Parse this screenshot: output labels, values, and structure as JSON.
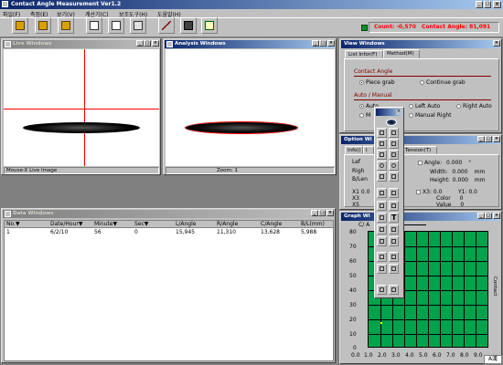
{
  "app": {
    "title": "Contact Angle Measurement Ver1.2"
  },
  "menu": [
    "파일(F)",
    "측정(E)",
    "보기(V)",
    "계산기(C)",
    "보조도구(H)",
    "도움말(H)"
  ],
  "status_top": {
    "count_label": "Count:",
    "count_value": "-0,570",
    "angle_label": "Contact Angle:",
    "angle_value": "81,091"
  },
  "live_window": {
    "title": "Live Windows",
    "status": "Mouse-X Live Image"
  },
  "analysis_window": {
    "title": "Analysis Windows",
    "status": "Zoom: 1"
  },
  "data_window": {
    "title": "Data Windows",
    "columns": [
      "No.▼",
      "Date/Hour▼",
      "Minute▼",
      "Sec▼",
      "L/Angle",
      "R/Angle",
      "C/Angle",
      "B/L(mm)"
    ],
    "rows": [
      [
        "1",
        "6/2/10",
        "56",
        "0",
        "15,945",
        "11,310",
        "13,628",
        "5,988"
      ]
    ]
  },
  "view_window": {
    "title": "View Windows",
    "tabs": [
      "List Infor(F)",
      "Method(M)"
    ],
    "contact_angle": {
      "label": "Contact Angle",
      "opt1": "Piece grab",
      "opt2": "Continue grab"
    },
    "auto_manual": {
      "label": "Auto / Manual",
      "opt1": "Auto",
      "opt2": "Left Auto",
      "opt3": "Right Auto",
      "opt4": "M",
      "opt5": "Manual Right"
    }
  },
  "option_window": {
    "title": "Option Wi",
    "tabs": [
      "Info()",
      "I",
      "Tension(T)"
    ],
    "left_labels": [
      "Lef",
      "Righ",
      "B/Len"
    ],
    "angle": {
      "label": "Angle:",
      "value": "0.000",
      "unit": "°"
    },
    "width": {
      "label": "Width:",
      "value": "0.000",
      "unit": "mm"
    },
    "height": {
      "label": "Height:",
      "value": "0.000",
      "unit": "mm"
    },
    "x1": {
      "label": "X1",
      "value": "0.0"
    },
    "x3": {
      "label": "X3:",
      "value": "0.0"
    },
    "y1": {
      "label": "Y1:",
      "value": "0.0"
    },
    "color": {
      "label": "Color",
      "value": "0"
    },
    "valuef": {
      "label": "Value",
      "value": "0"
    },
    "side_labels": [
      "X3",
      "X5"
    ]
  },
  "graph_window": {
    "title": "Graph Wi",
    "y_ticks": [
      "80",
      "70",
      "60",
      "50",
      "40",
      "30",
      "20",
      "10",
      "0"
    ],
    "x_ticks": [
      "0.0",
      "1.0",
      "2.0",
      "3.0",
      "4.0",
      "5.0",
      "6.0",
      "7.0",
      "8.0",
      "9.0"
    ],
    "right_label": "Contact",
    "legend": "C/ A"
  },
  "ime": {
    "label": "A漢"
  },
  "colors": {
    "graph_bg": "#00a24b",
    "count_text": "#ff0000",
    "title_active": "#0a246a"
  }
}
